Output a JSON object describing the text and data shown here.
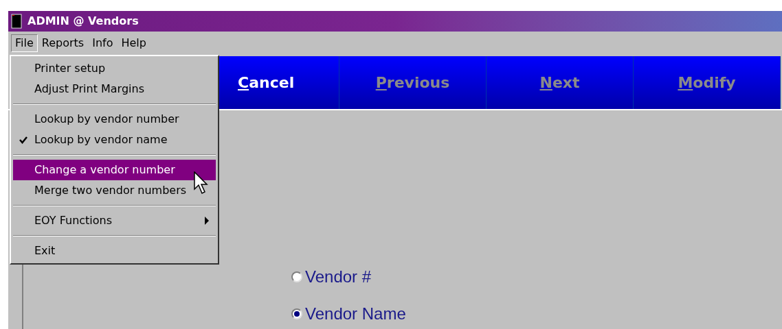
{
  "window": {
    "title": "ADMIN @ Vendors"
  },
  "menu_bar": [
    {
      "label": "File",
      "selected": true
    },
    {
      "label": "Reports",
      "selected": false
    },
    {
      "label": "Info",
      "selected": false
    },
    {
      "label": "Help",
      "selected": false
    }
  ],
  "file_menu": [
    {
      "kind": "item",
      "label": "Printer setup",
      "checked": false,
      "selected": false
    },
    {
      "kind": "item",
      "label": "Adjust Print Margins",
      "checked": false,
      "selected": false
    },
    {
      "kind": "separator"
    },
    {
      "kind": "item",
      "label": "Lookup by vendor number",
      "checked": false,
      "selected": false
    },
    {
      "kind": "item",
      "label": "Lookup by vendor name",
      "checked": true,
      "selected": false
    },
    {
      "kind": "separator"
    },
    {
      "kind": "item",
      "label": "Change a vendor number",
      "checked": false,
      "selected": true
    },
    {
      "kind": "item",
      "label": "Merge two vendor numbers",
      "checked": false,
      "selected": false
    },
    {
      "kind": "separator"
    },
    {
      "kind": "submenu",
      "label": "EOY Functions",
      "checked": false,
      "selected": false
    },
    {
      "kind": "separator"
    },
    {
      "kind": "item",
      "label": "Exit",
      "checked": false,
      "selected": false
    }
  ],
  "toolbar": [
    {
      "label": "Cancel",
      "disabled": false
    },
    {
      "label": "Previous",
      "disabled": true
    },
    {
      "label": "Next",
      "disabled": true
    },
    {
      "label": "Modify",
      "disabled": true
    }
  ],
  "lookup_options": [
    {
      "label": "Vendor #",
      "selected": false
    },
    {
      "label": "Vendor Name",
      "selected": true
    }
  ]
}
